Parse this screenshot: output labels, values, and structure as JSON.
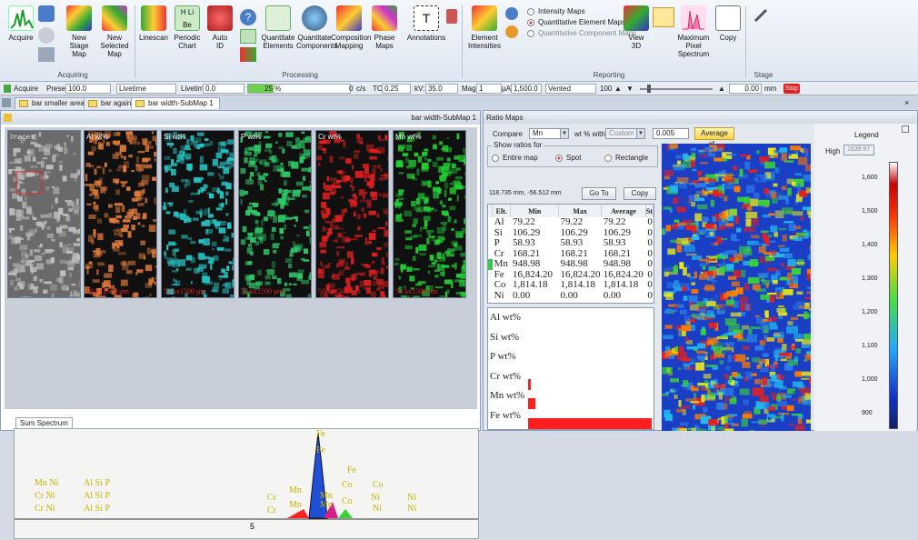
{
  "ribbon": {
    "acquiring": {
      "group_label": "Acquiring",
      "acquire": "Acquire",
      "new_stage_map": "New\nStage Map",
      "new_selected_map": "New\nSelected Map"
    },
    "processing": {
      "group_label": "Processing",
      "linescan": "Linescan",
      "periodic_chart": "Periodic\nChart",
      "auto_id": "Auto\nID",
      "quantitate_elements": "Quantitate\nElements",
      "quantitate_components": "Quantitate\nComponents",
      "composition_mapping": "Composition\nMapping",
      "phase_maps": "Phase\nMaps",
      "annotations": "Annotations"
    },
    "reporting": {
      "group_label": "Reporting",
      "element_intensities": "Element\nIntensities",
      "intensity_maps": "Intensity Maps",
      "quantitative_element_maps": "Quantitative Element Maps",
      "quantitative_component_maps": "Quantitative Component Maps",
      "view_3d": "View\n3D",
      "maximum_pixel_spectrum": "Maximum\nPixel Spectrum",
      "copy": "Copy"
    },
    "stage": {
      "group_label": "Stage"
    }
  },
  "statusbar": {
    "acquire": "Acquire",
    "preset_label": "Preset:",
    "preset_value": "100.0",
    "mode_value": "Livetime",
    "livetime_label": "Livetime:",
    "livetime_value": "0.0",
    "progress_text": "25 %",
    "progress_fraction": 0.25,
    "cps_value": "0",
    "cps_unit": "c/s",
    "tc_label": "TC:",
    "tc_value": "0.25",
    "kv_label": "kV:",
    "kv_value": "35.0",
    "mag_label": "Mag:",
    "mag_value": "1",
    "ua_label": "µA:",
    "ua_value": "1,500.0",
    "vac_value": "Vented",
    "count_value": "100",
    "pos_value": "0.00",
    "pos_unit": "mm",
    "stop": "Stop"
  },
  "tabs": [
    {
      "label": "bar smaller area"
    },
    {
      "label": "bar again2"
    },
    {
      "label": "bar width-SubMap 1"
    }
  ],
  "submap": {
    "title": "bar width-SubMap 1",
    "tiles": [
      {
        "label": "Image",
        "scale": "",
        "color": "#bfbfbf"
      },
      {
        "label": "Al wt%",
        "scale": "50  kx1500 µm",
        "color": "#e07a3a"
      },
      {
        "label": "Si wt%",
        "scale": "50  kx1500 µm",
        "color": "#27c6c6"
      },
      {
        "label": "P wt%",
        "scale": "50  kx1500 µm",
        "color": "#2ec96a"
      },
      {
        "label": "Cr wt%",
        "scale": "50  kx1500 µm",
        "color": "#e51f1f"
      },
      {
        "label": "Mn wt%",
        "scale": "50  kx1500 µm",
        "color": "#22d134"
      }
    ],
    "spectrum_tab": "Sum Spectrum",
    "spectrum_axis_tick": "5",
    "spectrum_labels": [
      "Mn Ni",
      "Cr Ni",
      "Cr Ni",
      "Al Si P",
      "Al Si P",
      "Al Si P",
      "Cr",
      "Cr",
      "Mn",
      "Mn",
      "Fe",
      "Fe",
      "Mn",
      "Mn",
      "Co",
      "Co",
      "Fe",
      "Co",
      "Ni",
      "Ni",
      "Ni",
      "Ni"
    ]
  },
  "ratio_maps": {
    "title": "Ratio Maps",
    "compare_label": "Compare",
    "compare_value": "Mn",
    "with_label": "wt % with",
    "with_value": "Custom",
    "custom_value": "0.005",
    "average_button": "Average of...",
    "show_ratios_label": "Show ratios for",
    "option_entire": "Entire map",
    "option_spot": "Spot",
    "option_rectangle": "Rectangle",
    "coordinates": "118.735 mm, -56.512 mm",
    "goto_button": "Go To",
    "copy_button": "Copy",
    "table": {
      "headers": [
        "Elt.",
        "Min",
        "Max",
        "Average",
        "St"
      ],
      "rows": [
        {
          "elt": "Al",
          "min": "79.22",
          "max": "79.22",
          "avg": "79.22",
          "st": "0"
        },
        {
          "elt": "Si",
          "min": "106.29",
          "max": "106.29",
          "avg": "106.29",
          "st": "0"
        },
        {
          "elt": "P",
          "min": "58.93",
          "max": "58.93",
          "avg": "58.93",
          "st": "0"
        },
        {
          "elt": "Cr",
          "min": "168.21",
          "max": "168.21",
          "avg": "168.21",
          "st": "0"
        },
        {
          "elt": "Mn",
          "min": "948.98",
          "max": "948.98",
          "avg": "948.98",
          "st": "0"
        },
        {
          "elt": "Fe",
          "min": "16,824.20",
          "max": "16,824.20",
          "avg": "16,824.20",
          "st": "0"
        },
        {
          "elt": "Co",
          "min": "1,814.18",
          "max": "1,814.18",
          "avg": "1,814.18",
          "st": "0"
        },
        {
          "elt": "Ni",
          "min": "0.00",
          "max": "0.00",
          "avg": "0.00",
          "st": "0"
        }
      ]
    },
    "histogram": [
      {
        "label": "Al wt%",
        "fraction": 0.0
      },
      {
        "label": "Si wt%",
        "fraction": 0.0
      },
      {
        "label": "P wt%",
        "fraction": 0.0
      },
      {
        "label": "Cr wt%",
        "fraction": 0.02
      },
      {
        "label": "Mn wt%",
        "fraction": 0.06
      },
      {
        "label": "Fe wt%",
        "fraction": 1.0
      }
    ],
    "legend": {
      "title": "Legend",
      "high_label": "High",
      "high_value": "1639.97",
      "ticks": [
        "1,600",
        "1,500",
        "1,400",
        "1,300",
        "1,200",
        "1,100",
        "1,000",
        "900"
      ]
    }
  },
  "colors": {
    "accent": "#f6d44c",
    "stop": "#e52020",
    "selected_row": "#2ecc40"
  }
}
